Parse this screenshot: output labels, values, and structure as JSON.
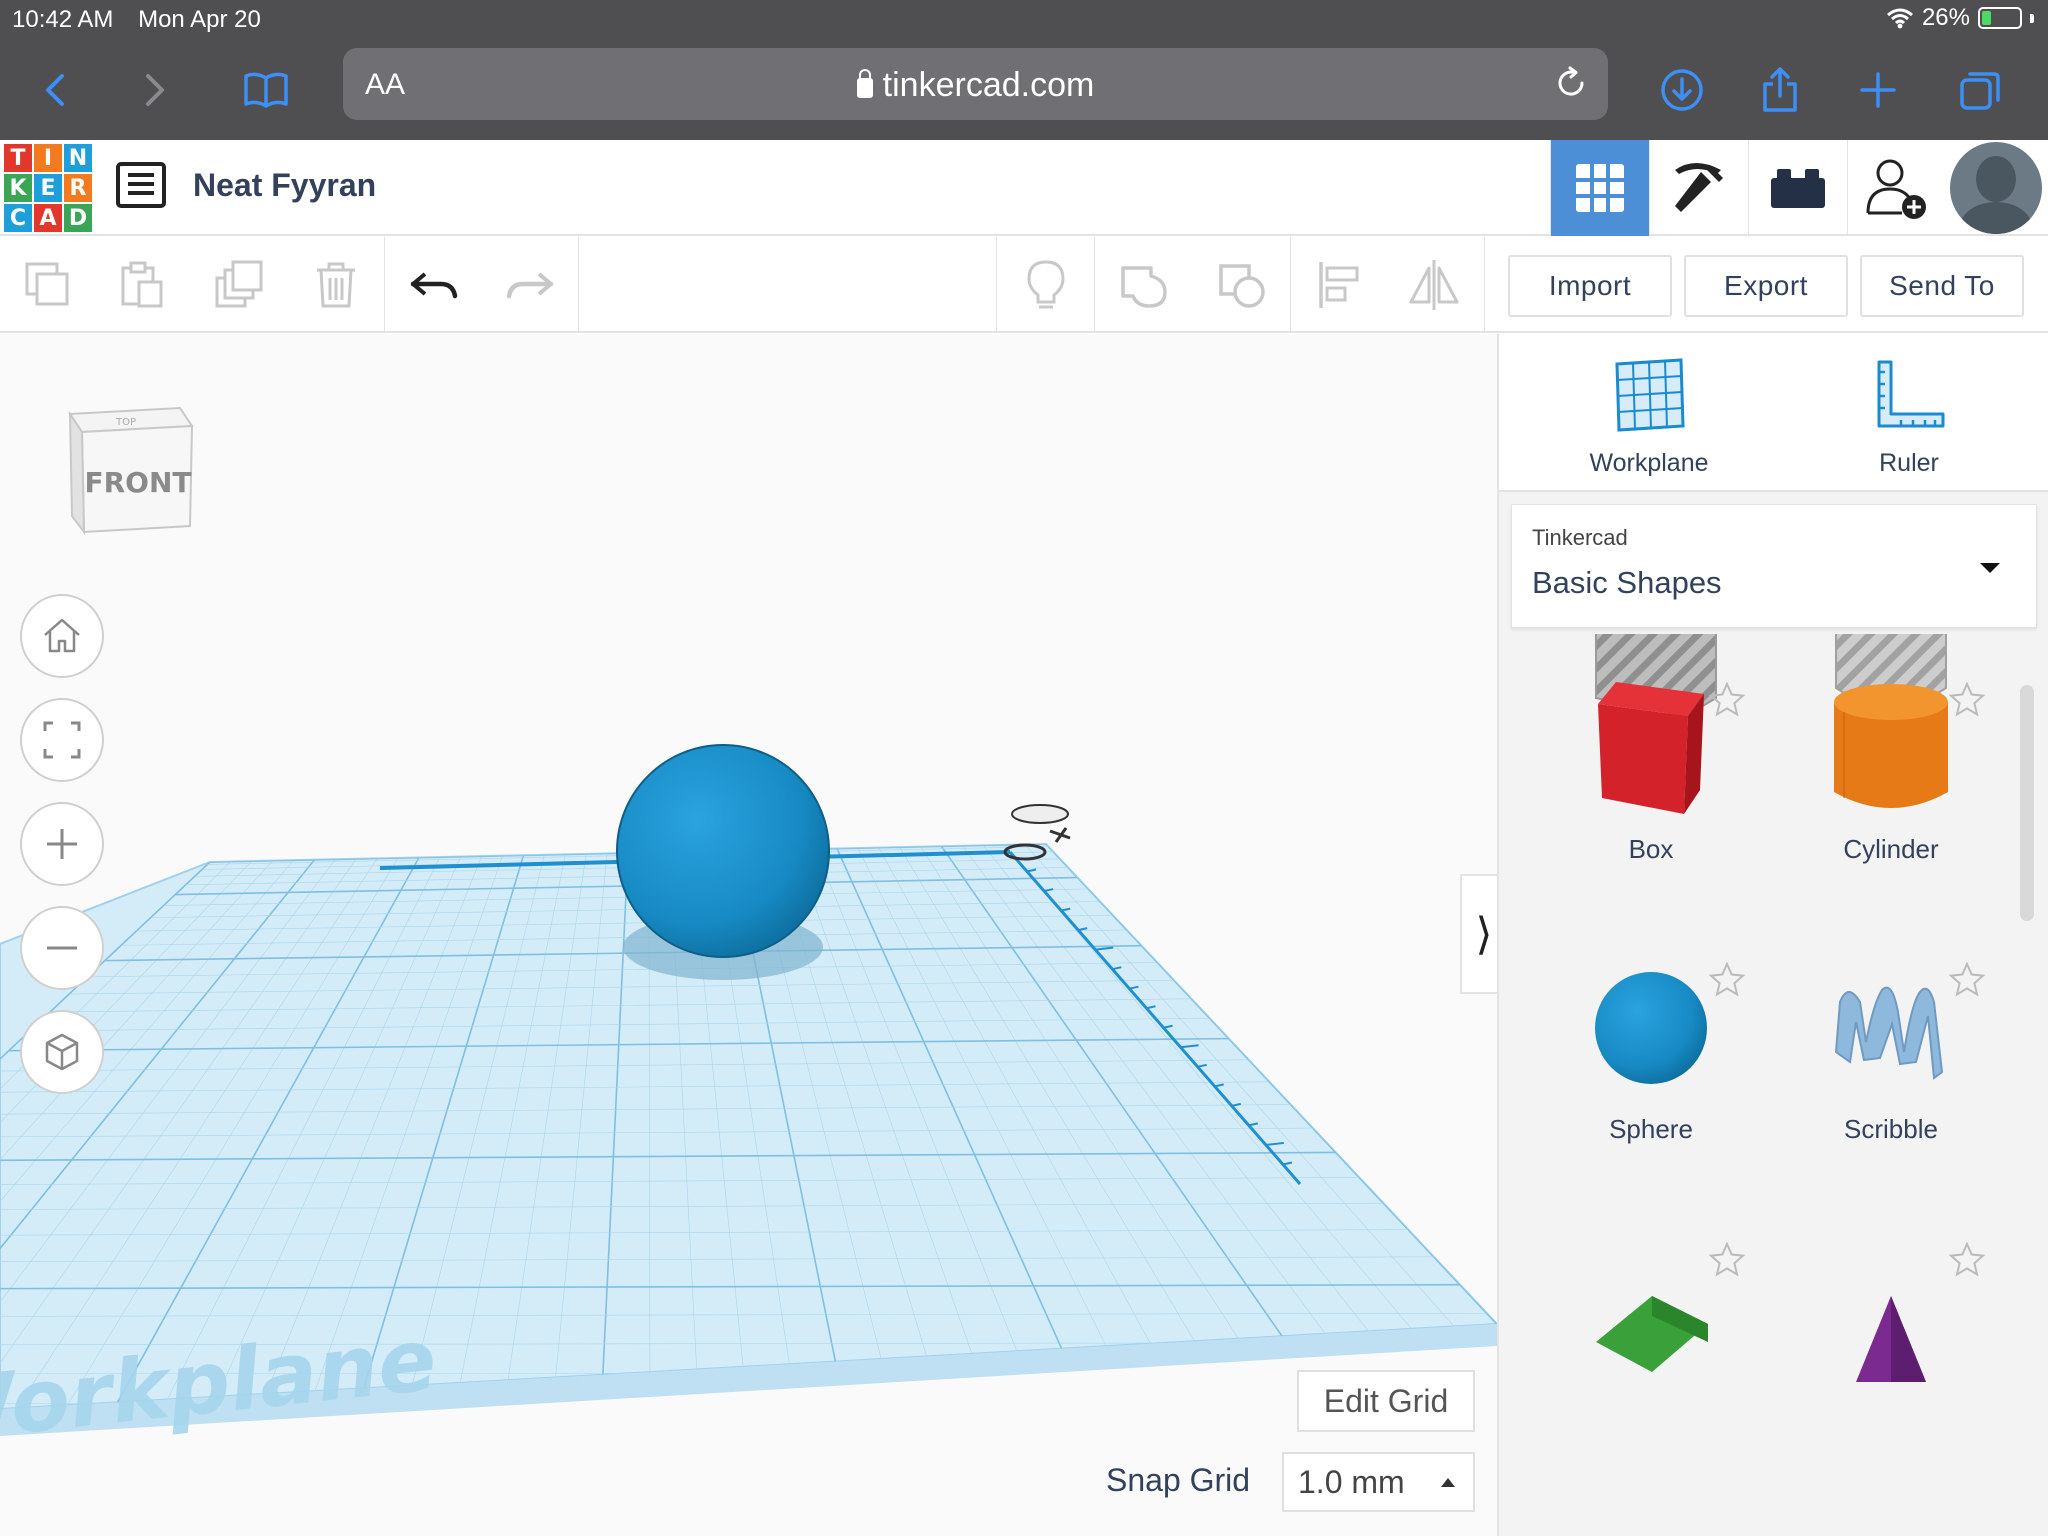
{
  "status_bar": {
    "time": "10:42 AM",
    "date": "Mon Apr 20",
    "battery_percent": "26%",
    "battery_level": 0.26
  },
  "browser": {
    "text_size_label": "AA",
    "url": "tinkercad.com"
  },
  "app": {
    "design_title": "Neat Fyyran",
    "logo_letters": [
      "T",
      "I",
      "N",
      "K",
      "E",
      "R",
      "C",
      "A",
      "D"
    ],
    "logo_colors": [
      "#e2382b",
      "#f47a20",
      "#1f9fd9",
      "#3aa655",
      "#1f9fd9",
      "#f47a20",
      "#1f9fd9",
      "#e2382b",
      "#3aa655"
    ],
    "header_icons": [
      "grid-view-icon",
      "pickaxe-icon",
      "bricks-icon",
      "add-user-icon",
      "avatar"
    ]
  },
  "toolbar": {
    "import_label": "Import",
    "export_label": "Export",
    "send_to_label": "Send To"
  },
  "viewport": {
    "view_cube_front": "FRONT",
    "view_cube_top": "TOP",
    "workplane_watermark": "Workplane",
    "edit_grid_label": "Edit Grid",
    "snap_grid_label": "Snap Grid",
    "snap_grid_value": "1.0 mm"
  },
  "panel": {
    "workplane_label": "Workplane",
    "ruler_label": "Ruler",
    "library_source": "Tinkercad",
    "library_name": "Basic Shapes",
    "shapes": [
      {
        "name": "Box",
        "style": "hole"
      },
      {
        "name": "Cylinder",
        "style": "hole"
      },
      {
        "name": "Box",
        "color": "#d3222a"
      },
      {
        "name": "Cylinder",
        "color": "#e67a17"
      },
      {
        "name": "Sphere",
        "color": "#1b8fc6"
      },
      {
        "name": "Scribble",
        "color": "#8fb8dd"
      },
      {
        "name": "",
        "color": "#3aa13a"
      },
      {
        "name": "",
        "color": "#7b2a8f"
      }
    ]
  },
  "colors": {
    "accent": "#4c8fd7",
    "workplane": "#cfe9f6",
    "grid_line": "#8cc7e6",
    "sphere": "#1b8fc6",
    "chrome": "#4f4f52"
  }
}
